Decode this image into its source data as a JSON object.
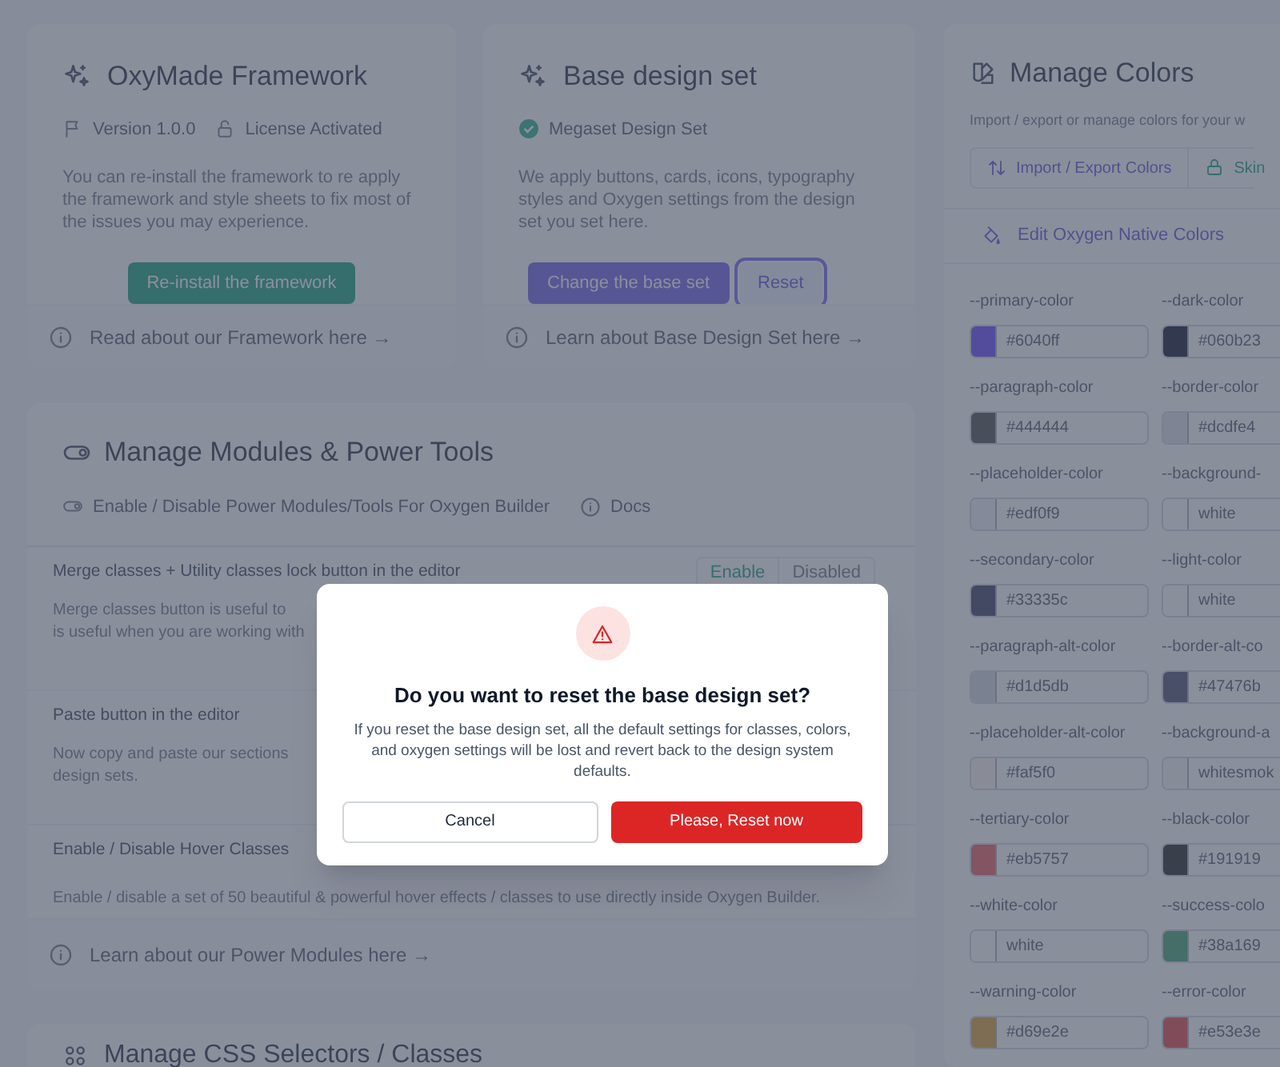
{
  "framework_card": {
    "title": "OxyMade Framework",
    "meta": [
      {
        "kind": "version",
        "text": "Version 1.0.0"
      },
      {
        "kind": "license",
        "text": "License Activated"
      }
    ],
    "description": "You can re-install the framework to re apply the framework and style sheets to fix most of the issues you may experience.",
    "button": "Re-install the framework",
    "footer_link": "Read about our Framework here →"
  },
  "design_card": {
    "title": "Base design set",
    "status": "Megaset Design Set",
    "description": "We apply buttons, cards, icons, typography styles and Oxygen settings from the design set you set here.",
    "buttons": [
      {
        "label": "Change the base set",
        "kind": "primary",
        "focused": false
      },
      {
        "label": "Reset",
        "kind": "outline",
        "focused": true
      }
    ],
    "footer_link": "Learn about Base Design Set here →"
  },
  "modules_card": {
    "title": "Manage Modules & Power Tools",
    "subtitle": "Enable / Disable Power Modules/Tools For Oxygen Builder",
    "docs": "Docs",
    "modules": [
      {
        "title": "Merge classes + Utility classes lock button in the editor",
        "description": [
          "Merge classes button is useful to",
          "is useful when you are working with"
        ],
        "toggle": [
          {
            "label": "Enable",
            "selected": true
          },
          {
            "label": "Disabled",
            "selected": false
          }
        ]
      },
      {
        "title": "Paste button in the editor",
        "description": [
          "Now copy and paste our sections",
          "design sets."
        ]
      },
      {
        "title": "Enable / Disable Hover Classes",
        "description": [
          "Enable / disable a set of 50 beautiful & powerful hover effects / classes to use directly inside Oxygen Builder."
        ]
      }
    ],
    "footer_link": "Learn about our Power Modules here →"
  },
  "selectors_card": {
    "title": "Manage CSS Selectors / Classes"
  },
  "colors_card": {
    "title": "Manage Colors",
    "description": "Import / export or manage colors for your w",
    "tabs": [
      {
        "label": "Import / Export Colors",
        "kind": "import"
      },
      {
        "label": "Skin",
        "kind": "skins"
      }
    ],
    "native_link": "Edit Oxygen Native Colors",
    "variables": [
      {
        "name": "--primary-color",
        "value": "#6040ff",
        "color": "#534c9c"
      },
      {
        "name": "--dark-color",
        "value": "#060b23",
        "color": "#333a4f"
      },
      {
        "name": "--paragraph-color",
        "value": "#444444",
        "color": "#494e5b"
      },
      {
        "name": "--border-color",
        "value": "#dcdfe4",
        "color": "#7e8493"
      },
      {
        "name": "--placeholder-color",
        "value": "#edf0f9",
        "color": "#848a9a"
      },
      {
        "name": "--background-",
        "value": "white",
        "color": "#8a8f9c"
      },
      {
        "name": "--secondary-color",
        "value": "#33335c",
        "color": "#434863"
      },
      {
        "name": "--light-color",
        "value": "white",
        "color": "#8a8f9c"
      },
      {
        "name": "--paragraph-alt-color",
        "value": "#d1d5db",
        "color": "#7a8190"
      },
      {
        "name": "--border-alt-co",
        "value": "#47476b",
        "color": "#4a4f68"
      },
      {
        "name": "--placeholder-alt-color",
        "value": "#faf5f0",
        "color": "#898c97"
      },
      {
        "name": "--background-a",
        "value": "whitesmok",
        "color": "#878c99"
      },
      {
        "name": "--tertiary-color",
        "value": "#eb5757",
        "color": "#835461"
      },
      {
        "name": "--black-color",
        "value": "#191919",
        "color": "#3a3f4c"
      },
      {
        "name": "--white-color",
        "value": "white",
        "color": "#8a8f9c"
      },
      {
        "name": "--success-colo",
        "value": "#38a169",
        "color": "#456e68"
      },
      {
        "name": "--warning-color",
        "value": "#d69e2e",
        "color": "#7c6d53"
      },
      {
        "name": "--error-color",
        "value": "#e53e3e",
        "color": "#814c59"
      }
    ]
  },
  "modal": {
    "title": "Do you want to reset the base design set?",
    "message": "If you reset the base design set, all the default settings for classes, colors, and oxygen settings will be lost and revert back to the design system defaults.",
    "buttons": [
      {
        "label": "Cancel",
        "kind": "secondary"
      },
      {
        "label": "Please, Reset now",
        "kind": "danger"
      }
    ]
  }
}
